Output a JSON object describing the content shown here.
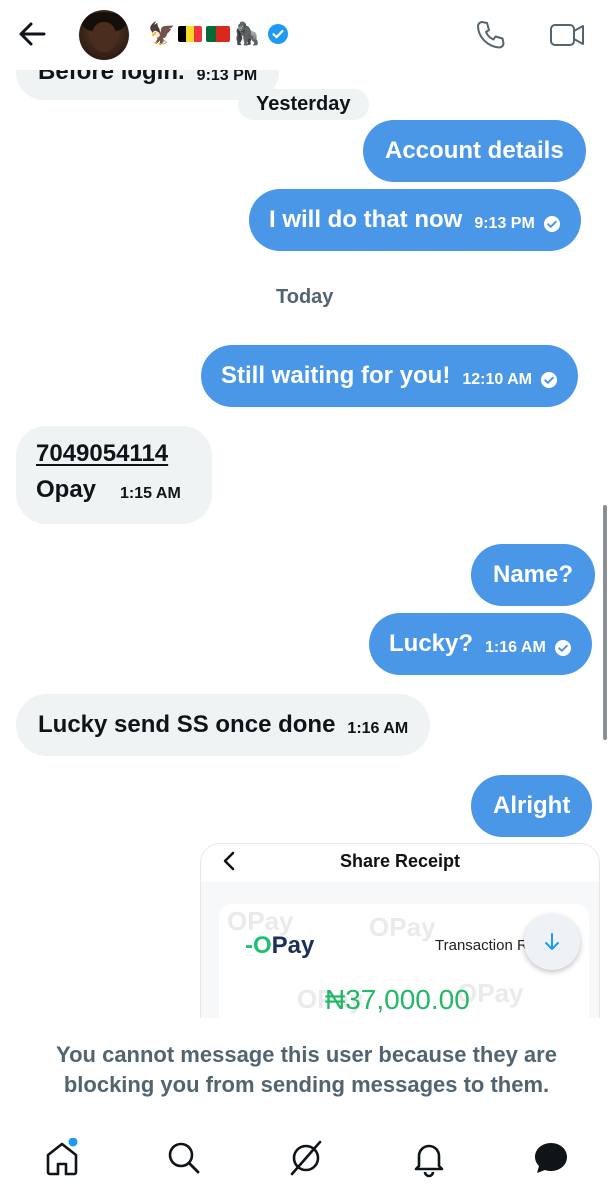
{
  "header": {
    "back_icon": "arrow-left-icon",
    "name_emojis": [
      "🦅",
      "🇧🇪",
      "🇵🇹",
      "🦍"
    ],
    "verified_icon": "verified-badge-icon",
    "verified_color": "#1d9bf0",
    "call_icon": "phone-icon",
    "video_icon": "video-camera-icon"
  },
  "messages": {
    "m0": {
      "text": "Before login.",
      "time": "9:13 PM"
    },
    "date_yesterday": "Yesterday",
    "m1": {
      "text": "Account details"
    },
    "m2": {
      "text": "I will do that now",
      "time": "9:13 PM"
    },
    "date_today": "Today",
    "m3": {
      "text": "Still waiting for you!",
      "time": "12:10 AM"
    },
    "m4": {
      "line1": "7049054114",
      "line2": "Opay",
      "time": "1:15 AM"
    },
    "m5": {
      "text": "Name?"
    },
    "m6": {
      "text": "Lucky?",
      "time": "1:16 AM"
    },
    "m7": {
      "text": "Lucky send SS once done",
      "time": "1:16 AM"
    },
    "m8": {
      "text": "Alright"
    }
  },
  "receipt": {
    "title": "Share Receipt",
    "logo_prefix": "-O",
    "logo_suffix": "Pay",
    "watermark": "OPay",
    "label": "Transaction R",
    "amount": "₦37,000.00"
  },
  "footer": {
    "blocked_message": "You cannot message this user because they are blocking you from sending messages to them."
  },
  "nav": {
    "items": [
      "home-icon",
      "search-icon",
      "grok-icon",
      "notifications-bell-icon",
      "messages-icon"
    ]
  },
  "colors": {
    "sent_bubble": "#4a97e8",
    "received_bubble": "#eff3f4",
    "muted_text": "#536471",
    "amount_green": "#22b865"
  }
}
